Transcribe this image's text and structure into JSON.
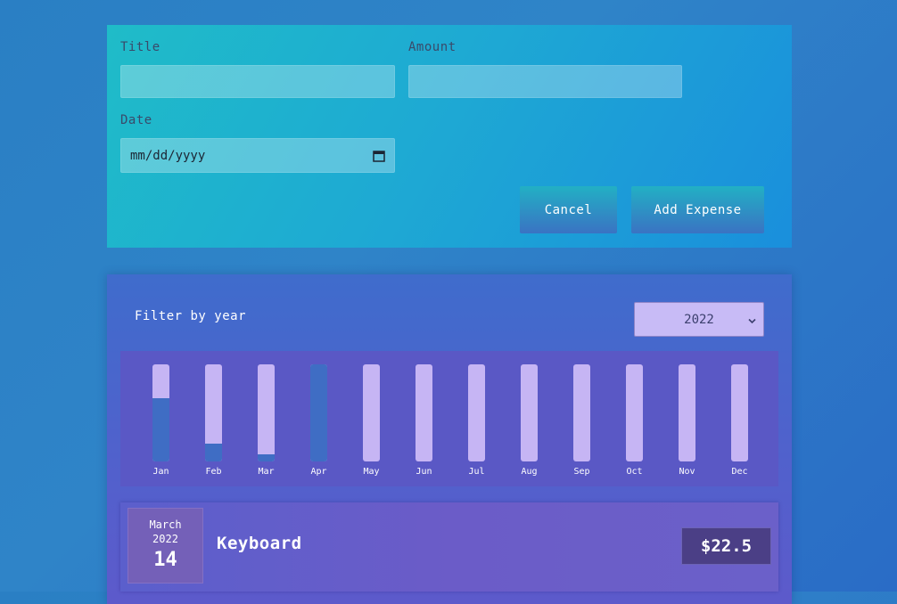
{
  "form": {
    "title_label": "Title",
    "title_value": "",
    "amount_label": "Amount",
    "amount_value": "",
    "date_label": "Date",
    "date_placeholder": "mm/dd/yyyy",
    "cancel_label": "Cancel",
    "submit_label": "Add Expense"
  },
  "filter": {
    "label": "Filter by year",
    "selected_year": "2022"
  },
  "chart_data": {
    "type": "bar",
    "categories": [
      "Jan",
      "Feb",
      "Mar",
      "Apr",
      "May",
      "Jun",
      "Jul",
      "Aug",
      "Sep",
      "Oct",
      "Nov",
      "Dec"
    ],
    "values": [
      0.65,
      0.18,
      0.07,
      1.0,
      0,
      0,
      0,
      0,
      0,
      0,
      0,
      0
    ],
    "ylim": [
      0,
      1
    ],
    "fill_color": "#3f6dc4",
    "track_color": "#c6b5f4"
  },
  "expenses": [
    {
      "month": "March",
      "year": "2022",
      "day": "14",
      "title": "Keyboard",
      "amount": "$22.5"
    }
  ]
}
